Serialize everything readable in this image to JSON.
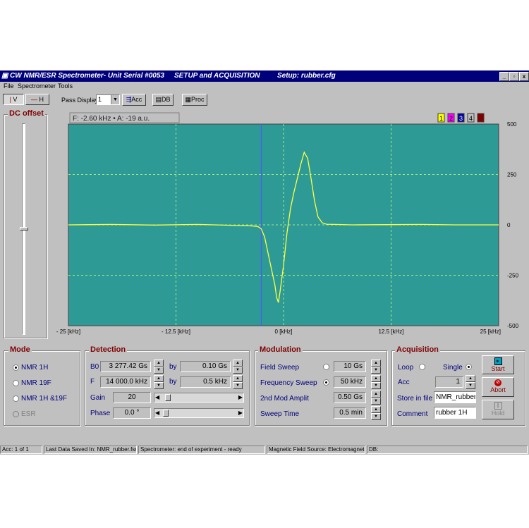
{
  "window": {
    "title_left": "CW NMR/ESR Spectrometer- Unit Serial #0053",
    "title_mid": "SETUP and ACQUISITION",
    "title_right": "Setup: rubber.cfg",
    "min_label": "_",
    "max_label": "▫",
    "close_label": "x"
  },
  "menu": {
    "file": "File",
    "spectrometer": "Spectrometer",
    "tools": "Tools"
  },
  "toolbar": {
    "v_label": "V",
    "h_label": "H",
    "pass_display_label": "Pass Display:",
    "pass_display_value": "1",
    "acc_label": "Acc",
    "db_label": "DB",
    "proc_label": "Proc"
  },
  "dc_offset": {
    "label": "DC offset"
  },
  "plot": {
    "readout": "F: -2.60 kHz • A: -19 a.u.",
    "channels": [
      {
        "label": "1",
        "color": "#ffff00",
        "text_color": "#000000"
      },
      {
        "label": "2",
        "color": "#ff00ff",
        "text_color": "#000000"
      },
      {
        "label": "3",
        "color": "#0000a0",
        "text_color": "#ffffff"
      },
      {
        "label": "4",
        "color": "#c0c0c0",
        "text_color": "#000000"
      },
      {
        "label": "5",
        "color": "#800000",
        "text_color": "#800000"
      }
    ],
    "background": "#2e9a96",
    "trace_color": "#ffff40",
    "cursor_color": "#5050ff"
  },
  "chart_data": {
    "type": "line",
    "x_ticks": [
      "- 25 [kHz]",
      "- 12.5 [kHz]",
      "0 [kHz]",
      "12.5 [kHz]",
      "25 [kHz]"
    ],
    "y_ticks": [
      "500",
      "250",
      "0",
      "-250",
      "-500"
    ],
    "xlim": [
      -25,
      25
    ],
    "ylim": [
      -500,
      500
    ],
    "grid": true,
    "cursor_x": -2.6,
    "series": [
      {
        "x": [
          -25,
          -20,
          -15,
          -10,
          -6,
          -4,
          -3,
          -2.6,
          -2.2,
          -1.8,
          -1.4,
          -1.0,
          -0.8,
          -0.6,
          -0.4,
          0,
          0.4,
          0.8,
          1.2,
          1.6,
          2.0,
          2.4,
          2.8,
          3.2,
          3.6,
          4.0,
          4.5,
          5.0,
          6,
          8,
          12,
          16,
          20,
          25
        ],
        "y": [
          0,
          2,
          -1,
          2,
          -2,
          -4,
          -8,
          -19,
          -60,
          -140,
          -220,
          -300,
          -360,
          -385,
          -330,
          -200,
          -40,
          80,
          160,
          230,
          300,
          360,
          330,
          230,
          120,
          40,
          10,
          3,
          2,
          0,
          1,
          2,
          0,
          0
        ]
      }
    ]
  },
  "mode": {
    "label": "Mode",
    "options": [
      {
        "label": "NMR 1H",
        "selected": true,
        "enabled": true
      },
      {
        "label": "NMR 19F",
        "selected": false,
        "enabled": true
      },
      {
        "label": "NMR 1H &19F",
        "selected": false,
        "enabled": true
      },
      {
        "label": "ESR",
        "selected": false,
        "enabled": false
      }
    ]
  },
  "detection": {
    "label": "Detection",
    "b0_label": "B0",
    "b0_value": "3 277.42 Gs",
    "b0_by_label": "by",
    "b0_by_value": "0.10 Gs",
    "f_label": "F",
    "f_value": "14 000.0 kHz",
    "f_by_label": "by",
    "f_by_value": "0.5 kHz",
    "gain_label": "Gain",
    "gain_value": "20",
    "gain_level": 0.05,
    "phase_label": "Phase",
    "phase_value": "0.0 °",
    "phase_level": 0.02
  },
  "modulation": {
    "label": "Modulation",
    "field_sweep_label": "Field Sweep",
    "field_sweep_value": "10 Gs",
    "field_sweep_selected": false,
    "freq_sweep_label": "Frequency Sweep",
    "freq_sweep_value": "50 kHz",
    "freq_sweep_selected": true,
    "mod_amp_label": "2nd Mod Amplit",
    "mod_amp_value": "0.50 Gs",
    "sweep_time_label": "Sweep Time",
    "sweep_time_value": "0.5 min"
  },
  "acquisition": {
    "label": "Acquisition",
    "loop_label": "Loop",
    "single_label": "Single",
    "acc_label": "Acc",
    "acc_value": "1",
    "store_label": "Store in file",
    "store_value": "NMR_rubber",
    "comment_label": "Comment",
    "comment_value": "rubber 1H",
    "start_label": "Start",
    "abort_label": "Abort",
    "hold_label": "Hold"
  },
  "status": {
    "acc": "Acc: 1 of 1",
    "last_saved": "Last Data Saved In: NMR_rubber.fsr",
    "spectrometer": "Spectrometer: end of experiment - ready",
    "field_source": "Magnetic Field Source: Electromagnet",
    "db": "DB:"
  }
}
